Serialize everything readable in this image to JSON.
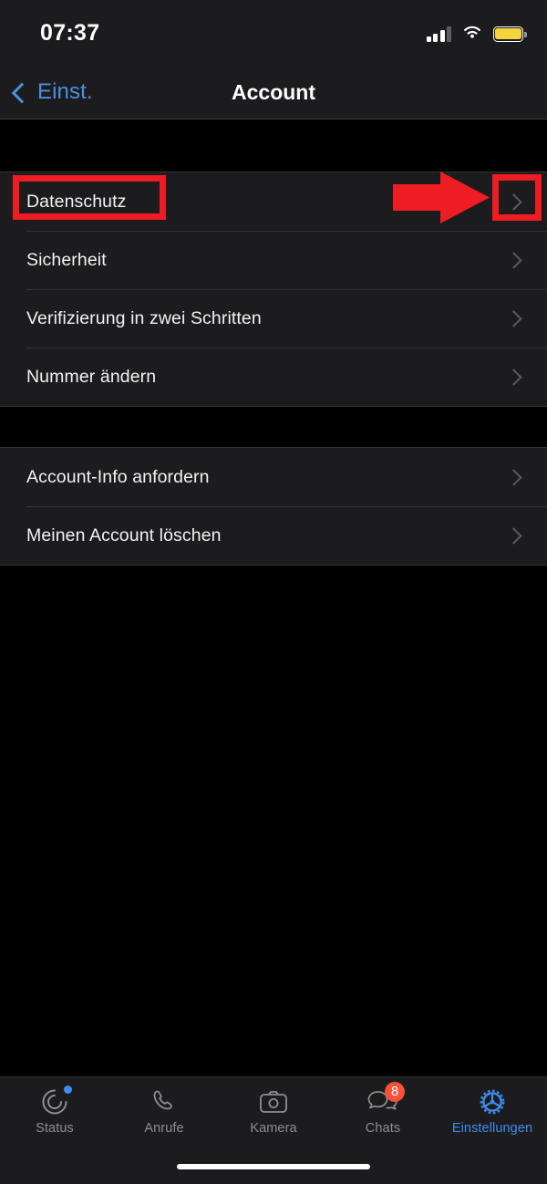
{
  "status_bar": {
    "time": "07:37",
    "signal_icon": "cellular-bars-icon",
    "wifi_icon": "wifi-icon",
    "battery_icon": "battery-icon",
    "battery_color": "#f5d33c"
  },
  "nav": {
    "back_label": "Einst.",
    "back_icon": "chevron-left-icon",
    "title": "Account",
    "accent_color": "#4a90e2"
  },
  "groups": [
    {
      "rows": [
        {
          "label": "Datenschutz",
          "chevron": "chevron-right-icon"
        },
        {
          "label": "Sicherheit",
          "chevron": "chevron-right-icon"
        },
        {
          "label": "Verifizierung in zwei Schritten",
          "chevron": "chevron-right-icon"
        },
        {
          "label": "Nummer ändern",
          "chevron": "chevron-right-icon"
        }
      ]
    },
    {
      "rows": [
        {
          "label": "Account-Info anfordern",
          "chevron": "chevron-right-icon"
        },
        {
          "label": "Meinen Account löschen",
          "chevron": "chevron-right-icon"
        }
      ]
    }
  ],
  "annotations": {
    "color": "#ee1c23",
    "highlight_label": "Datenschutz",
    "arrow_icon": "right-arrow-annotation",
    "boxes": [
      "datenschutz-label-box",
      "datenschutz-chevron-box"
    ]
  },
  "tabbar": {
    "items": [
      {
        "label": "Status",
        "icon": "status-rings-icon",
        "active": false,
        "dot": true
      },
      {
        "label": "Anrufe",
        "icon": "phone-icon",
        "active": false,
        "dot": false
      },
      {
        "label": "Kamera",
        "icon": "camera-icon",
        "active": false,
        "dot": false
      },
      {
        "label": "Chats",
        "icon": "chat-bubbles-icon",
        "active": false,
        "badge": "8"
      },
      {
        "label": "Einstellungen",
        "icon": "gear-icon",
        "active": true,
        "dot": false
      }
    ],
    "active_color": "#3c8df0",
    "inactive_color": "#8e8e93",
    "badge_color": "#fa5238"
  }
}
